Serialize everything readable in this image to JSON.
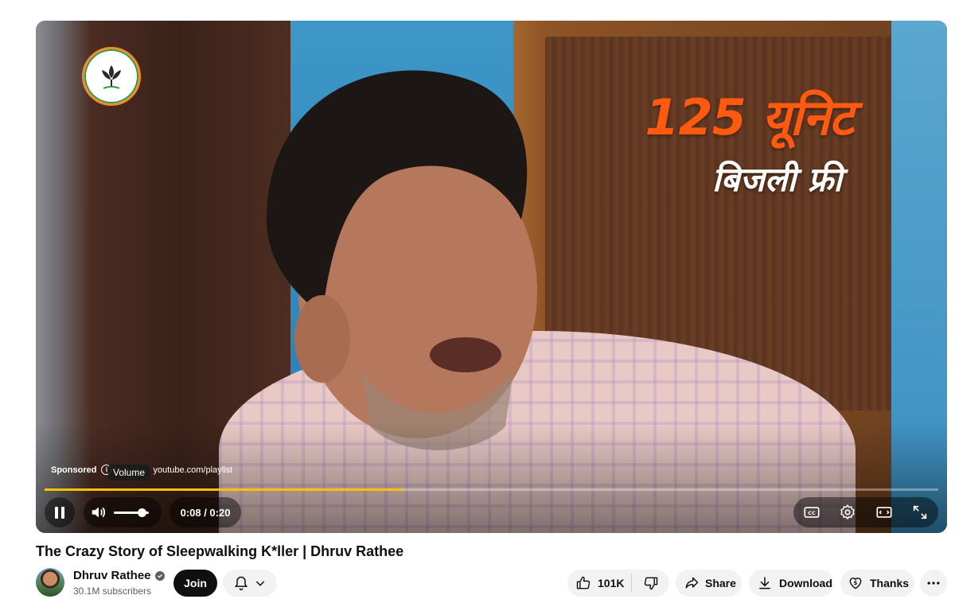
{
  "player": {
    "ad_label": "Sponsored",
    "ad_url": "youtube.com/playlist",
    "tooltip": "Volume",
    "overlay_line1": "125 यूनिट",
    "overlay_line2": "बिजली फ्री",
    "time_display": "0:08 / 0:20",
    "progress": 0.4,
    "volume_level": 0.8,
    "progress_color": "#ffc107",
    "overlay_accent": "#ff5a10"
  },
  "video": {
    "title": "The Crazy Story of Sleepwalking K*ller | Dhruv Rathee"
  },
  "channel": {
    "name": "Dhruv Rathee",
    "subscribers": "30.1M subscribers",
    "join_label": "Join"
  },
  "actions": {
    "likes": "101K",
    "share": "Share",
    "download": "Download",
    "thanks": "Thanks"
  },
  "icons": [
    "party-logo-icon",
    "info-icon",
    "pause-icon",
    "volume-icon",
    "captions-icon",
    "settings-icon",
    "miniplayer-icon",
    "fullscreen-icon",
    "verified-icon",
    "bell-icon",
    "chevron-down-icon",
    "thumbs-up-icon",
    "thumbs-down-icon",
    "share-icon",
    "download-icon",
    "thanks-icon",
    "more-icon"
  ]
}
